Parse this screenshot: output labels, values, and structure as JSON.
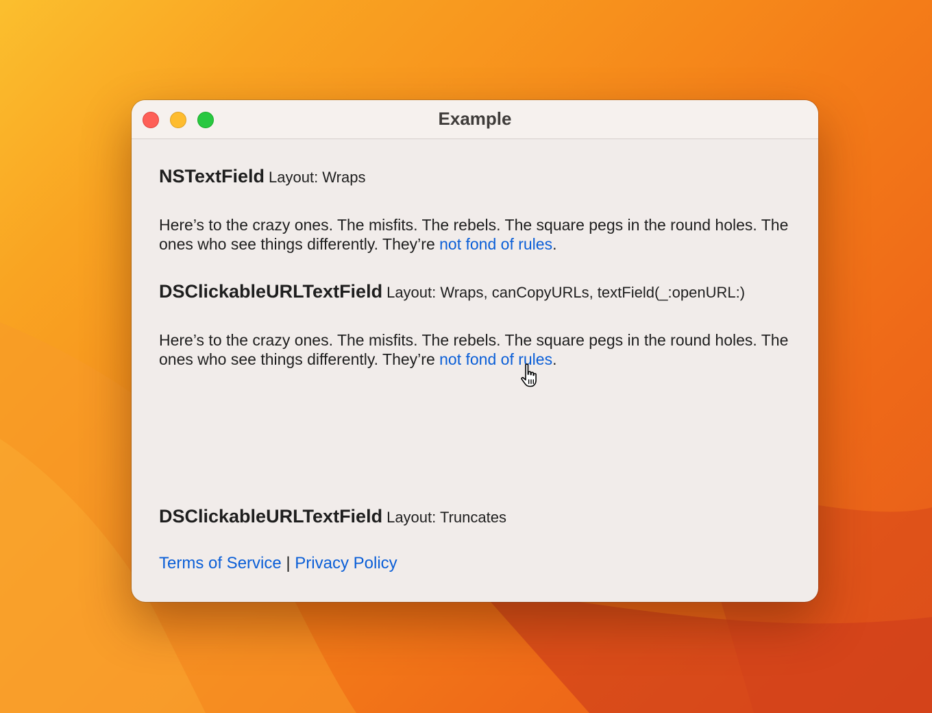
{
  "window": {
    "title": "Example"
  },
  "sections": [
    {
      "class_name": "NSTextField",
      "layout": "Layout: Wraps",
      "text_before": "Here’s to the crazy ones. The misfits. The rebels. The square pegs in the round holes. The ones who see things differently. They’re ",
      "link": "not fond of rules",
      "text_after": "."
    },
    {
      "class_name": "DSClickableURLTextField",
      "layout": "Layout: Wraps, canCopyURLs, textField(_:openURL:)",
      "text_before": "Here’s to the crazy ones. The misfits. The rebels. The square pegs in the round holes. The ones who see things differently. They’re ",
      "link": "not fond of rules",
      "text_after": "."
    },
    {
      "class_name": "DSClickableURLTextField",
      "layout": "Layout: Truncates",
      "link_1": "Terms of Service",
      "separator": "|",
      "link_2": "Privacy Policy"
    }
  ],
  "colors": {
    "link": "#0a5ed7",
    "close": "#fe5f57",
    "minimize": "#febc2e",
    "zoom": "#28c840"
  },
  "icons": {
    "cursor": "pointing-hand-cursor-icon"
  }
}
